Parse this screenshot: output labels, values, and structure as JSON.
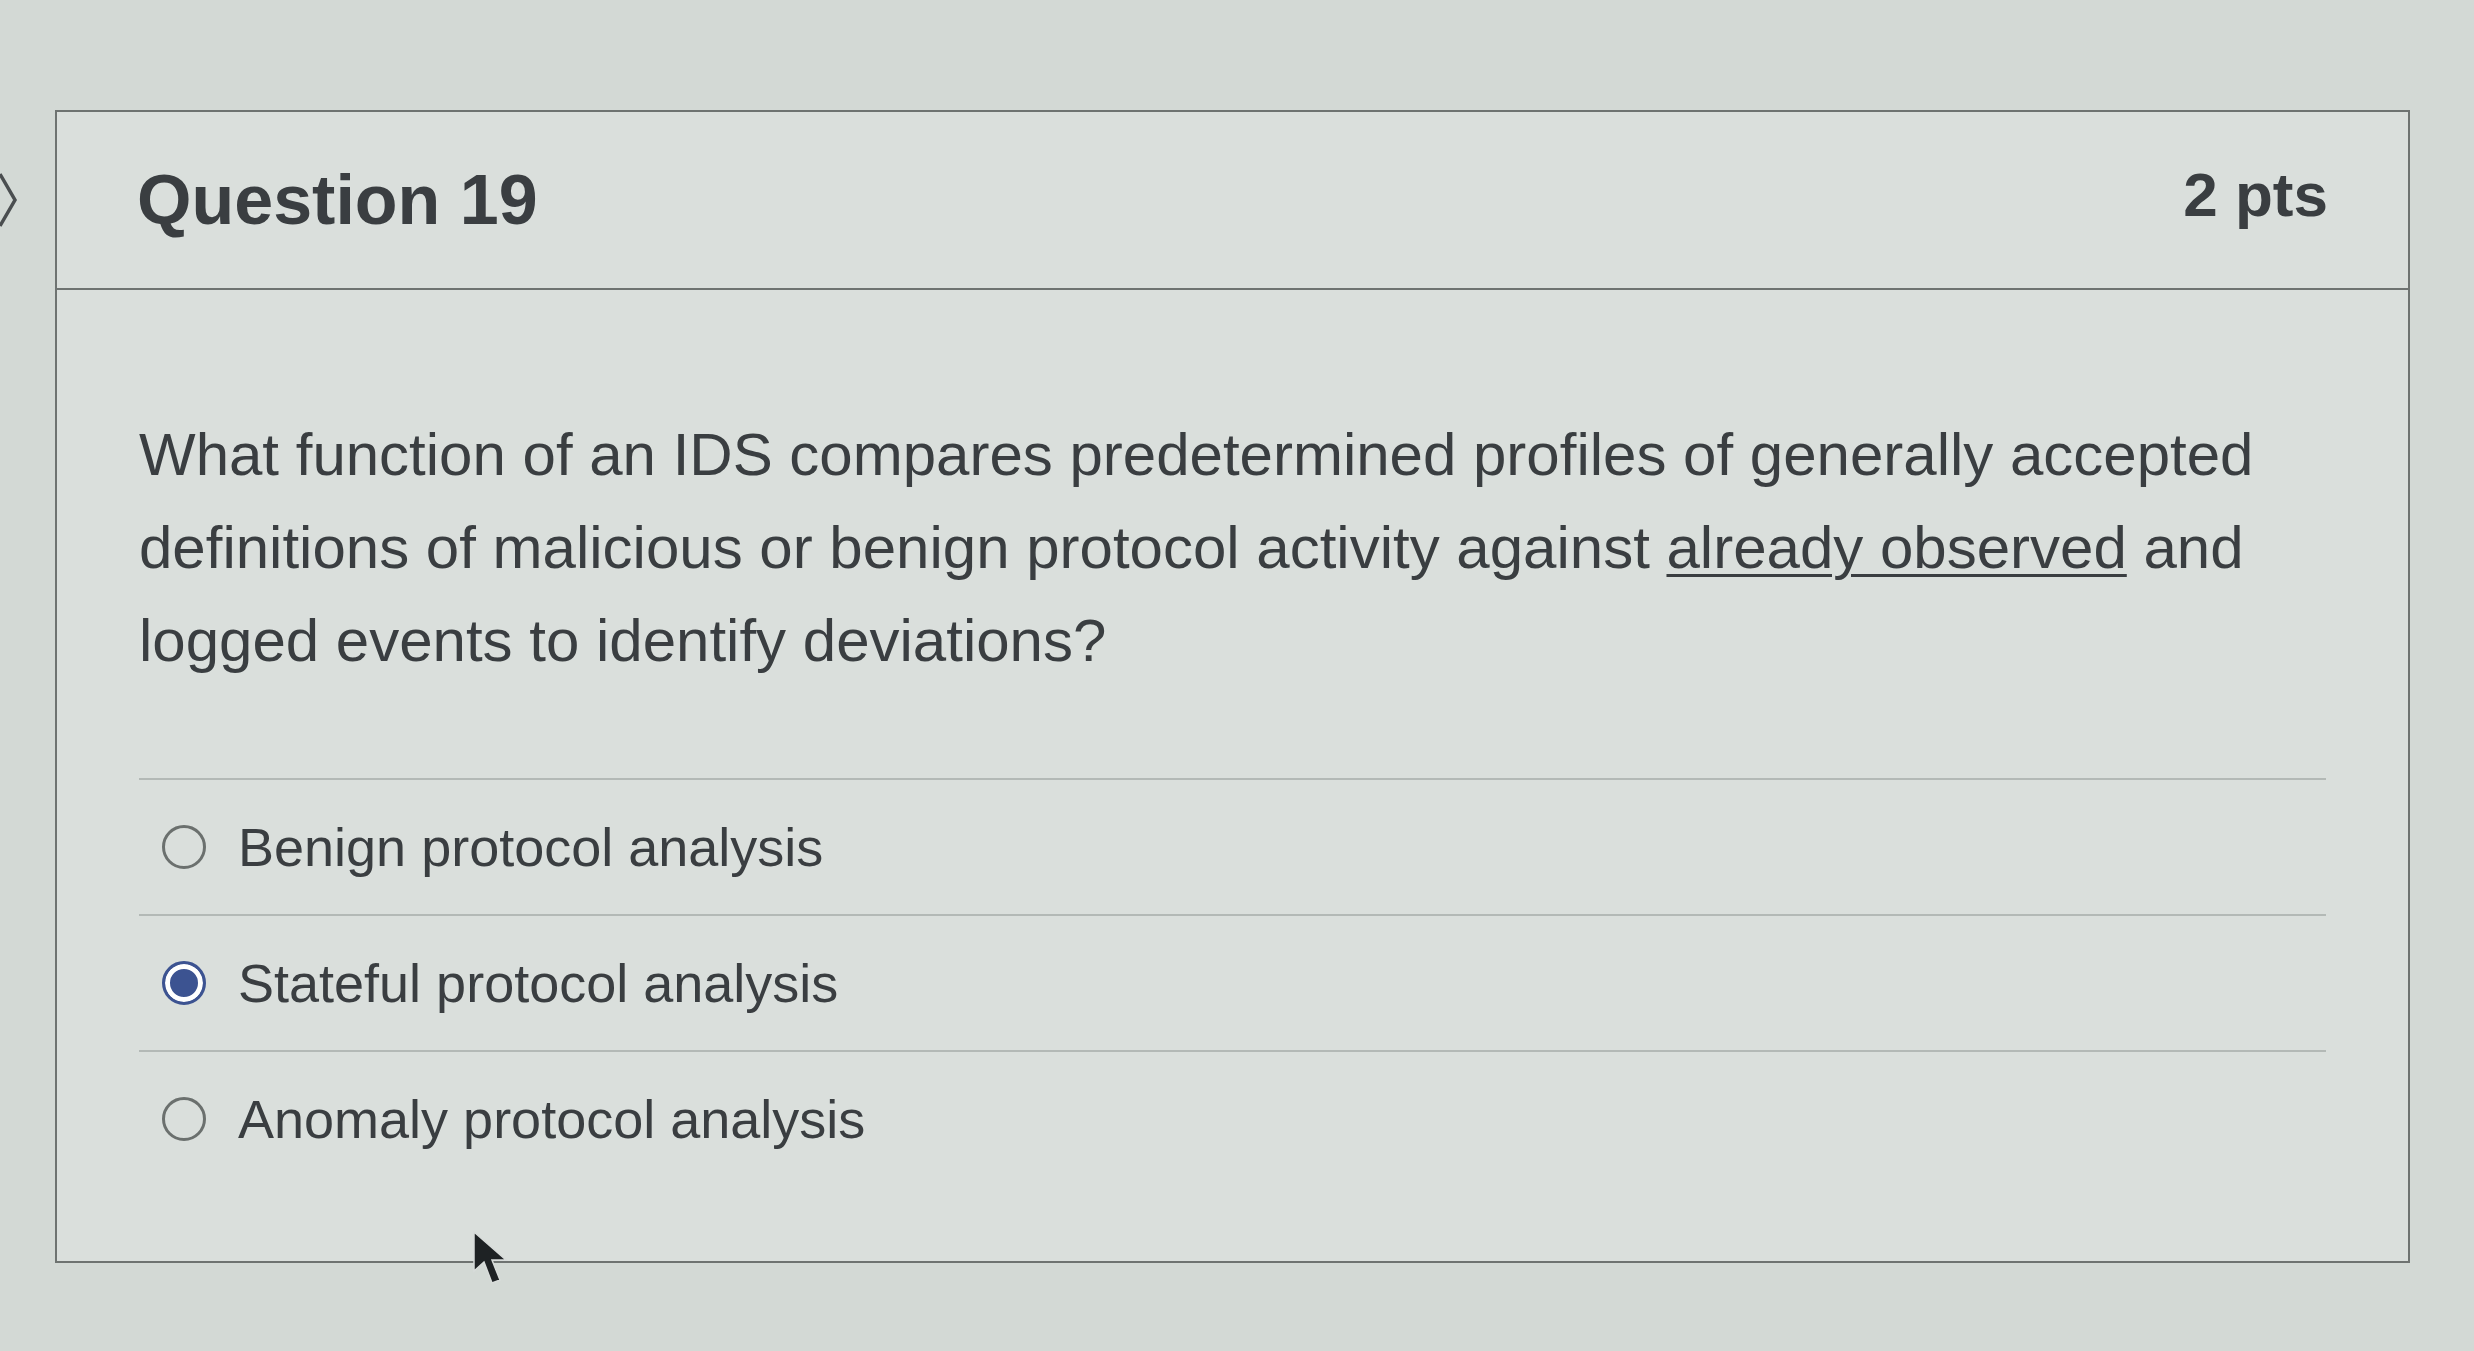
{
  "question": {
    "title": "Question 19",
    "points": "2 pts",
    "text": [
      {
        "text": "What function of an IDS compares predetermined profiles of generally accepted definitions of malicious or benign protocol activity against ",
        "underlined": false
      },
      {
        "text": "already observed",
        "underlined": true
      },
      {
        "text": " and logged events to identify deviations?",
        "underlined": false
      }
    ]
  },
  "answers": [
    {
      "label": "Benign protocol analysis",
      "selected": false
    },
    {
      "label": "Stateful protocol analysis",
      "selected": true
    },
    {
      "label": "Anomaly protocol analysis",
      "selected": false
    }
  ]
}
